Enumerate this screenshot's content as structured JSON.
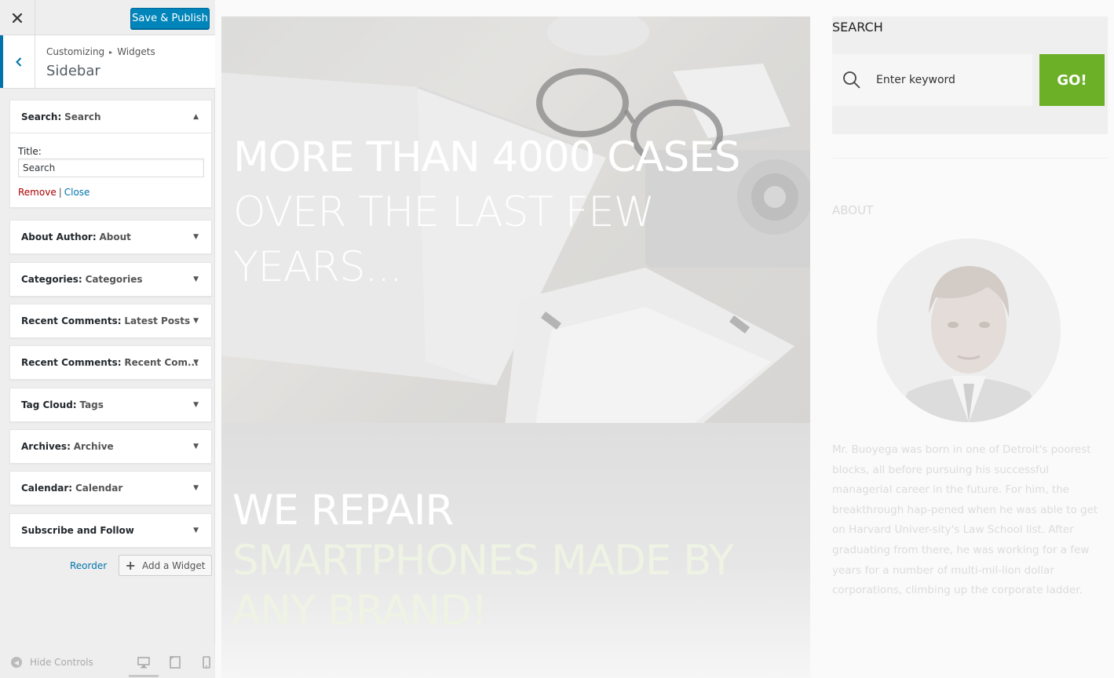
{
  "header": {
    "close_icon": "close-icon",
    "save_label": "Save & Publish"
  },
  "section": {
    "breadcrumb_root": "Customizing",
    "breadcrumb_leaf": "Widgets",
    "title": "Sidebar"
  },
  "widgets": [
    {
      "type": "Search:",
      "name": "Search",
      "expanded": true
    },
    {
      "type": "About Author:",
      "name": "About",
      "expanded": false
    },
    {
      "type": "Categories:",
      "name": "Categories",
      "expanded": false
    },
    {
      "type": "Recent Comments:",
      "name": "Latest Posts",
      "expanded": false
    },
    {
      "type": "Recent Comments:",
      "name": "Recent Com...",
      "expanded": false
    },
    {
      "type": "Tag Cloud:",
      "name": "Tags",
      "expanded": false
    },
    {
      "type": "Archives:",
      "name": "Archive",
      "expanded": false
    },
    {
      "type": "Calendar:",
      "name": "Calendar",
      "expanded": false
    },
    {
      "type": "Subscribe and Follow",
      "name": "",
      "expanded": false
    }
  ],
  "search_widget_form": {
    "title_label": "Title:",
    "title_value": "Search",
    "remove_label": "Remove",
    "separator": "|",
    "close_label": "Close"
  },
  "actions": {
    "reorder_label": "Reorder",
    "add_widget_label": "Add a Widget"
  },
  "footer": {
    "hide_controls_label": "Hide Controls",
    "devices": [
      "desktop-icon",
      "tablet-icon",
      "mobile-icon"
    ],
    "active_device": "desktop"
  },
  "preview": {
    "hero_line1": "MORE THAN 4000 CASES",
    "hero_line2": "OVER THE LAST FEW YEARS...",
    "repair_line1": "WE REPAIR",
    "repair_line2": "SMARTPHONES MADE BY ANY BRAND!",
    "search_title": "SEARCH",
    "search_placeholder": "Enter keyword",
    "go_label": "GO!",
    "about_title": "ABOUT",
    "about_text": "Mr. Buoyega was born in one of Detroit's poorest blocks, all before pursuing his successful managerial career in the future. For him, the breakthrough hap-pened when he was able to get on Harvard Univer-sity's Law School list. After graduating from there, he was working for a few years for a number of multi-mil-lion dollar corporations, climbing up the corporate ladder."
  },
  "colors": {
    "primary_button": "#0085ba",
    "accent_bar": "#0073aa",
    "remove_link": "#aa0000",
    "go_button": "#6bb026"
  }
}
